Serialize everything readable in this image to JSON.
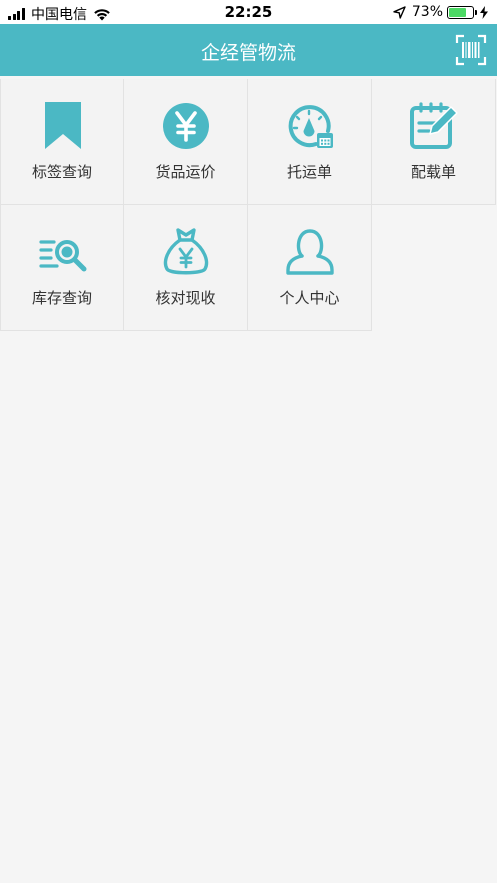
{
  "status_bar": {
    "carrier": "中国电信",
    "time": "22:25",
    "battery_percent": "73%",
    "battery_level": 0.73
  },
  "nav": {
    "title": "企经管物流",
    "scan_icon": "barcode-scan-icon"
  },
  "colors": {
    "accent": "#4bb8c4",
    "background": "#f5f5f5"
  },
  "menu": [
    {
      "label": "标签查询",
      "icon": "bookmark-icon"
    },
    {
      "label": "货品运价",
      "icon": "yuan-coin-icon"
    },
    {
      "label": "托运单",
      "icon": "gauge-calendar-icon"
    },
    {
      "label": "配载单",
      "icon": "notepad-pen-icon"
    },
    {
      "label": "库存查询",
      "icon": "list-search-icon"
    },
    {
      "label": "核对现收",
      "icon": "money-bag-icon"
    },
    {
      "label": "个人中心",
      "icon": "user-icon"
    }
  ]
}
